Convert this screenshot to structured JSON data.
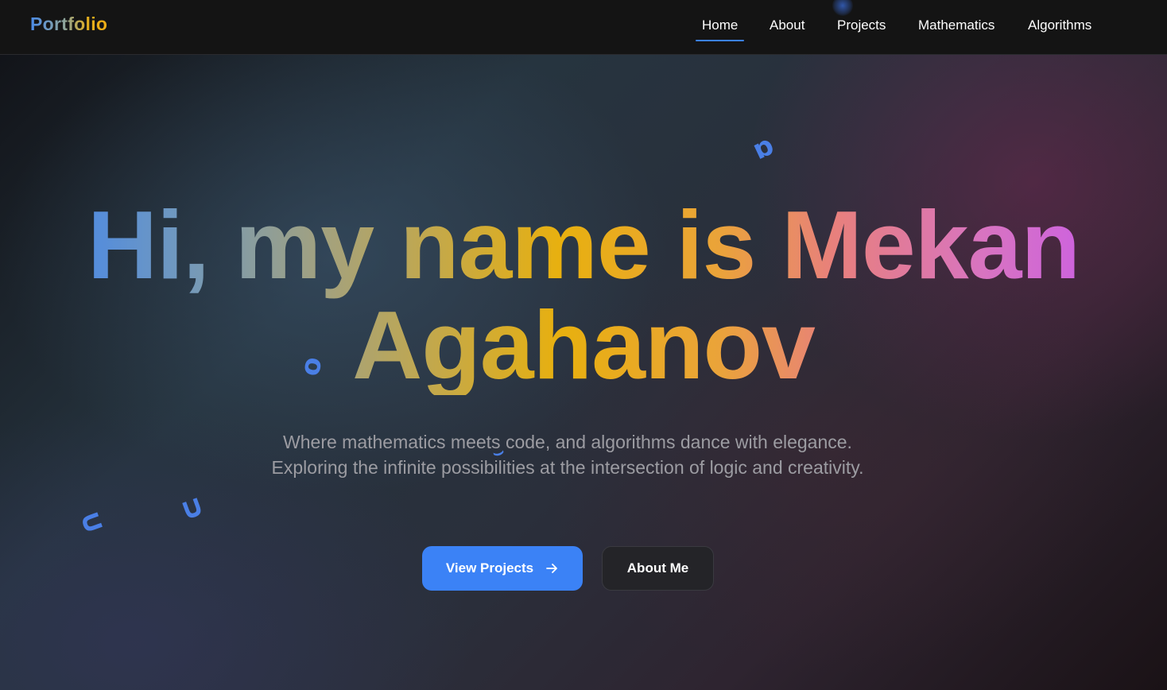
{
  "nav": {
    "logo": "Portfolio",
    "links": [
      "Home",
      "About",
      "Projects",
      "Mathematics",
      "Algorithms"
    ],
    "active": "Home"
  },
  "hero": {
    "title": "Hi, my name is Mekan Agahanov",
    "subtitle": "Where mathematics meets code, and algorithms dance with elegance. Exploring the infinite possibilities at the intersection of logic and creativity.",
    "primary_button": "View Projects",
    "secondary_button": "About Me"
  },
  "colors": {
    "accent": "#3b82f6",
    "background": "#141414",
    "gradient_start": "#3b82f6",
    "gradient_mid": "#e8b00f",
    "gradient_end": "#c657f2"
  },
  "icons": {
    "button_icon": "arrow-right-icon"
  }
}
